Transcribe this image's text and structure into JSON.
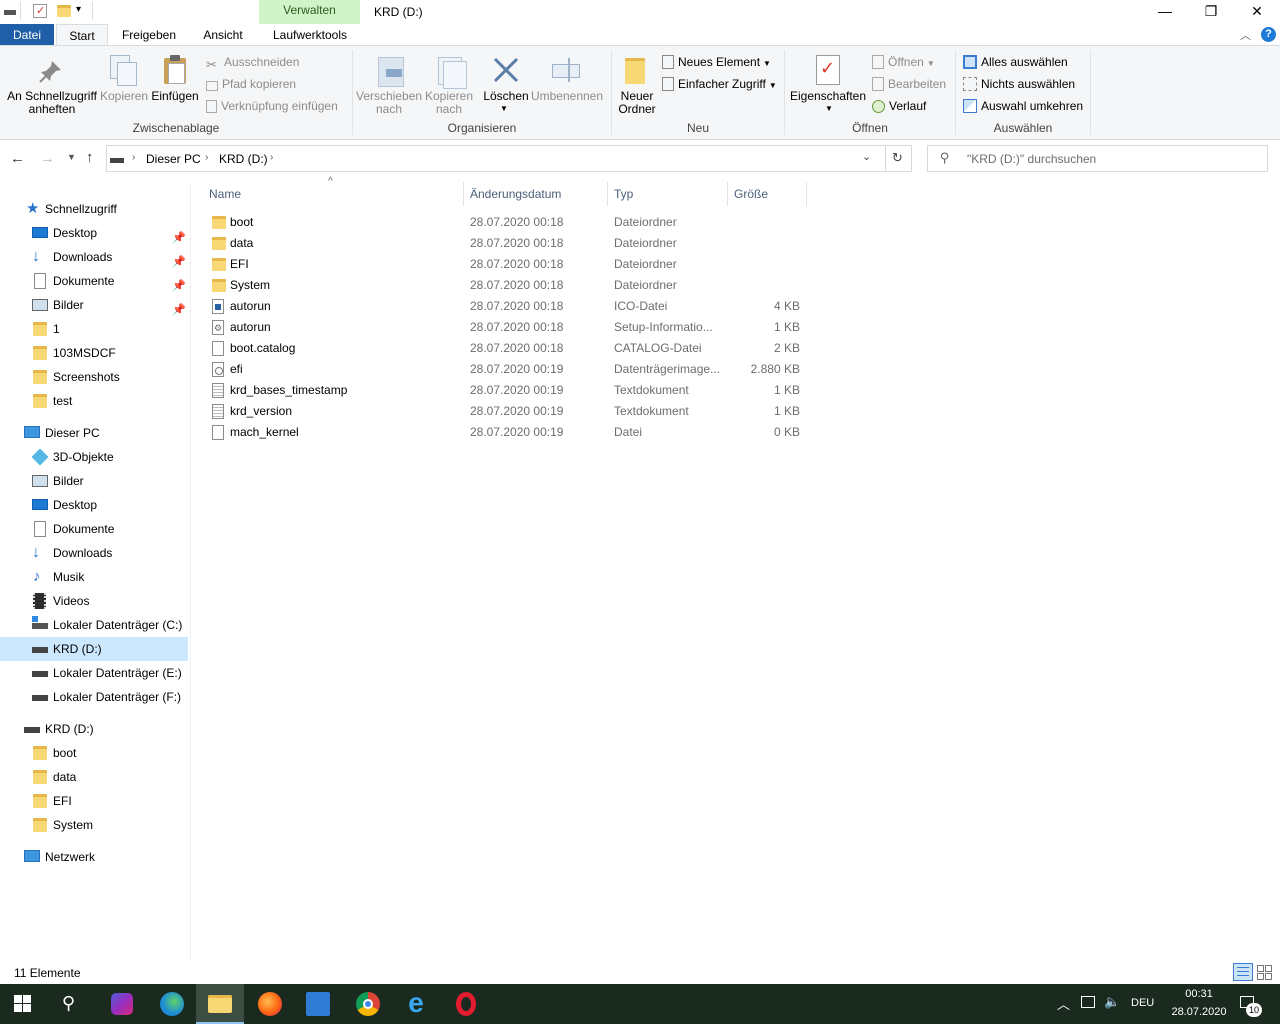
{
  "window": {
    "title": "KRD (D:)",
    "contextual_group": "Verwalten",
    "controls": {
      "minimize": "—",
      "maximize": "❐",
      "close": "✕"
    }
  },
  "tabs": [
    {
      "label": "Datei"
    },
    {
      "label": "Start"
    },
    {
      "label": "Freigeben"
    },
    {
      "label": "Ansicht"
    },
    {
      "label": "Laufwerktools"
    }
  ],
  "ribbon": {
    "clipboard": {
      "title": "Zwischenablage",
      "pin": "An Schnellzugriff\nanheften",
      "pin_l1": "An Schnellzugriff",
      "pin_l2": "anheften",
      "copy": "Kopieren",
      "paste": "Einfügen",
      "cut": "Ausschneiden",
      "copy_path": "Pfad kopieren",
      "paste_shortcut": "Verknüpfung einfügen"
    },
    "organize": {
      "title": "Organisieren",
      "move_l1": "Verschieben",
      "move_l2": "nach",
      "copyto_l1": "Kopieren",
      "copyto_l2": "nach",
      "delete": "Löschen",
      "rename": "Umbenennen"
    },
    "new": {
      "title": "Neu",
      "folder_l1": "Neuer",
      "folder_l2": "Ordner",
      "new_item": "Neues Element",
      "easy_access": "Einfacher Zugriff"
    },
    "open": {
      "title": "Öffnen",
      "properties": "Eigenschaften",
      "open": "Öffnen",
      "edit": "Bearbeiten",
      "history": "Verlauf"
    },
    "select": {
      "title": "Auswählen",
      "select_all": "Alles auswählen",
      "select_none": "Nichts auswählen",
      "invert": "Auswahl umkehren"
    }
  },
  "address": {
    "crumbs": [
      "Dieser PC",
      "KRD (D:)"
    ],
    "search_placeholder": "\"KRD (D:)\" durchsuchen"
  },
  "nav": {
    "quick_access": "Schnellzugriff",
    "quick_items": [
      "Desktop",
      "Downloads",
      "Dokumente",
      "Bilder",
      "1",
      "103MSDCF",
      "Screenshots",
      "test"
    ],
    "this_pc": "Dieser PC",
    "pc_items": [
      "3D-Objekte",
      "Bilder",
      "Desktop",
      "Dokumente",
      "Downloads",
      "Musik",
      "Videos",
      "Lokaler Datenträger (C:)",
      "KRD (D:)",
      "Lokaler Datenträger (E:)",
      "Lokaler Datenträger (F:)"
    ],
    "drive": "KRD (D:)",
    "drive_items": [
      "boot",
      "data",
      "EFI",
      "System"
    ],
    "network": "Netzwerk"
  },
  "columns": {
    "name": "Name",
    "date": "Änderungsdatum",
    "type": "Typ",
    "size": "Größe"
  },
  "files": [
    {
      "name": "boot",
      "date": "28.07.2020 00:18",
      "type": "Dateiordner",
      "size": "",
      "icon": "folder-icon"
    },
    {
      "name": "data",
      "date": "28.07.2020 00:18",
      "type": "Dateiordner",
      "size": "",
      "icon": "folder-icon"
    },
    {
      "name": "EFI",
      "date": "28.07.2020 00:18",
      "type": "Dateiordner",
      "size": "",
      "icon": "folder-icon"
    },
    {
      "name": "System",
      "date": "28.07.2020 00:18",
      "type": "Dateiordner",
      "size": "",
      "icon": "folder-icon"
    },
    {
      "name": "autorun",
      "date": "28.07.2020 00:18",
      "type": "ICO-Datei",
      "size": "4 KB",
      "icon": "ico-file-icon"
    },
    {
      "name": "autorun",
      "date": "28.07.2020 00:18",
      "type": "Setup-Informatio...",
      "size": "1 KB",
      "icon": "setup-file-icon"
    },
    {
      "name": "boot.catalog",
      "date": "28.07.2020 00:18",
      "type": "CATALOG-Datei",
      "size": "2 KB",
      "icon": "file-icon"
    },
    {
      "name": "efi",
      "date": "28.07.2020 00:19",
      "type": "Datenträgerimage...",
      "size": "2.880 KB",
      "icon": "disk-image-icon"
    },
    {
      "name": "krd_bases_timestamp",
      "date": "28.07.2020 00:19",
      "type": "Textdokument",
      "size": "1 KB",
      "icon": "text-file-icon"
    },
    {
      "name": "krd_version",
      "date": "28.07.2020 00:19",
      "type": "Textdokument",
      "size": "1 KB",
      "icon": "text-file-icon"
    },
    {
      "name": "mach_kernel",
      "date": "28.07.2020 00:19",
      "type": "Datei",
      "size": "0 KB",
      "icon": "file-icon"
    }
  ],
  "status": {
    "count": "11 Elemente"
  },
  "taskbar": {
    "lang": "DEU",
    "time": "00:31",
    "date": "28.07.2020",
    "notifications": "10"
  }
}
